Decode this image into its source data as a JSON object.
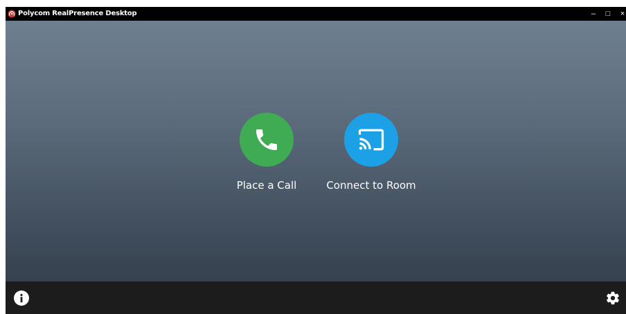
{
  "window": {
    "title": "Polycom RealPresence Desktop",
    "controls": {
      "minimize": "–",
      "maximize": "□",
      "close": "×"
    }
  },
  "actions": {
    "place_call": {
      "label": "Place a Call",
      "color": "#3fac54",
      "icon": "phone-icon"
    },
    "connect_room": {
      "label": "Connect to Room",
      "color": "#1da1e6",
      "icon": "cast-icon"
    }
  },
  "footer": {
    "info_icon": "info-icon",
    "settings_icon": "gear-icon"
  },
  "colors": {
    "titlebar": "#000000",
    "bottombar": "#1c1c1c",
    "logo": "#c8352b"
  }
}
